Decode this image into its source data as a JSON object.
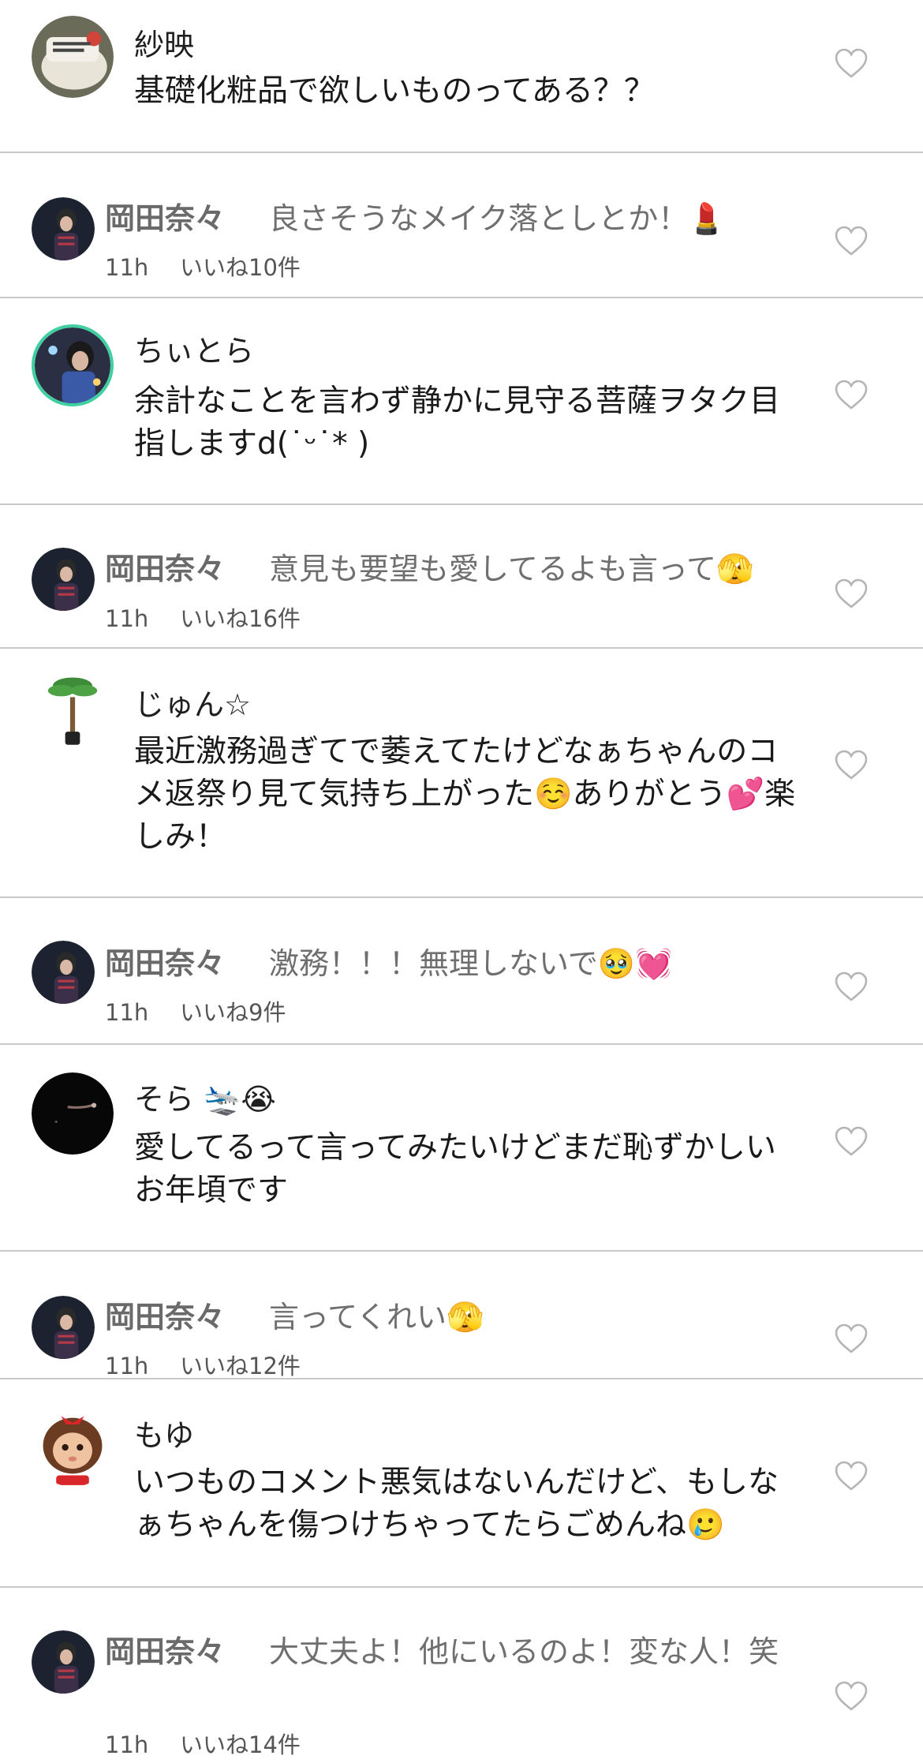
{
  "comments": [
    {
      "type": "comment",
      "avatar": "avatar-cake",
      "user": "紗映",
      "text": "基礎化粧品で欲しいものってある？？",
      "liked": false
    },
    {
      "type": "reply",
      "avatar": "avatar-okada",
      "user": "岡田奈々",
      "text": "良さそうなメイク落としとか！💄",
      "time": "11h",
      "likes": "いいね10件",
      "liked": false
    },
    {
      "type": "comment",
      "avatar": "avatar-concert",
      "user": "ちぃとら",
      "text": "余計なことを言わず静かに見守る菩薩ヲタク目指しますd(˙ᵕ˙* )",
      "liked": false
    },
    {
      "type": "reply",
      "avatar": "avatar-okada",
      "user": "岡田奈々",
      "text": "意見も要望も愛してるよも言って🫣",
      "time": "11h",
      "likes": "いいね16件",
      "liked": false
    },
    {
      "type": "comment",
      "avatar": "avatar-plant",
      "user": "じゅん☆",
      "text": "最近激務過ぎてで萎えてたけどなぁちゃんのコメ返祭り見て気持ち上がった☺️ありがとう💕楽しみ！",
      "liked": false
    },
    {
      "type": "reply",
      "avatar": "avatar-okada",
      "user": "岡田奈々",
      "text": "激務！！！無理しないで🥹💓",
      "time": "11h",
      "likes": "いいね9件",
      "liked": false
    },
    {
      "type": "comment",
      "avatar": "avatar-dark",
      "user": "そら 🛬😭",
      "text": "愛してるって言ってみたいけどまだ恥ずかしいお年頃です",
      "liked": false
    },
    {
      "type": "reply",
      "avatar": "avatar-okada",
      "user": "岡田奈々",
      "text": "言ってくれい🫣",
      "time": "11h",
      "likes": "いいね12件",
      "liked": false
    },
    {
      "type": "comment",
      "avatar": "avatar-monchhichi",
      "user": "もゆ",
      "text": "いつものコメント悪気はないんだけど、もしなぁちゃんを傷つけちゃってたらごめんね🥲",
      "liked": false
    },
    {
      "type": "reply",
      "avatar": "avatar-okada",
      "user": "岡田奈々",
      "text": "大丈夫よ！他にいるのよ！変な人！笑",
      "time": "11h",
      "likes": "いいね14件",
      "liked": false
    }
  ],
  "colors": {
    "divider": "#c9c9c9",
    "reply_text": "#6f6f6f",
    "heart_outline": "#b5b5b5"
  },
  "icons": {
    "like": "heart-outline-icon"
  }
}
